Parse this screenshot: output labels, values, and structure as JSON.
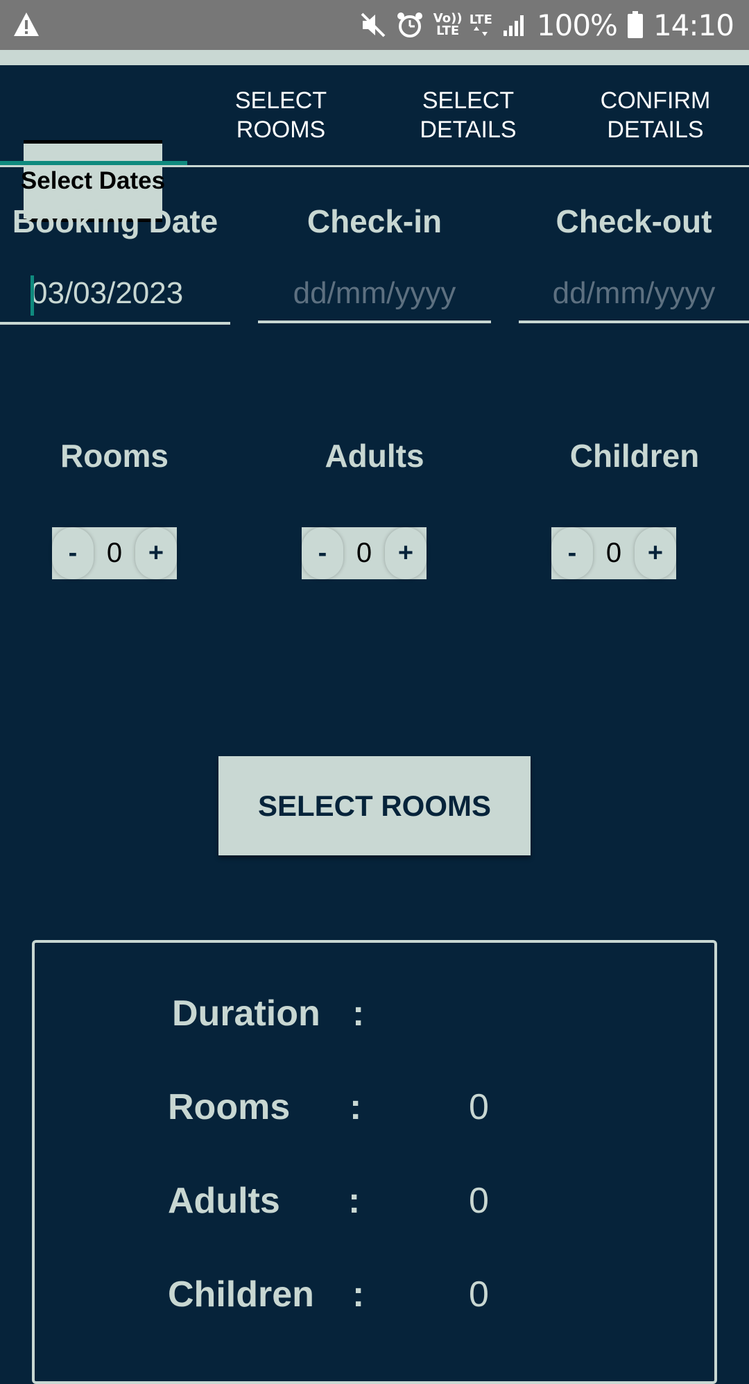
{
  "status_bar": {
    "battery": "100%",
    "time": "14:10",
    "volte": "Vo))\nLTE",
    "lte": "LTE",
    "icons": [
      "warning-icon",
      "mute-icon",
      "alarm-icon",
      "volte-icon",
      "lte-icon",
      "signal-icon",
      "battery-icon"
    ]
  },
  "tabs": [
    {
      "label": "Select Dates",
      "active": true
    },
    {
      "label": "SELECT\nROOMS",
      "active": false
    },
    {
      "label": "SELECT\nDETAILS",
      "active": false
    },
    {
      "label": "CONFIRM\nDETAILS",
      "active": false
    }
  ],
  "dates": {
    "booking_label": "Booking Date",
    "booking_value": "03/03/2023",
    "checkin_label": "Check-in",
    "checkin_placeholder": "dd/mm/yyyy",
    "checkout_label": "Check-out",
    "checkout_placeholder": "dd/mm/yyyy"
  },
  "counters": {
    "rooms": {
      "label": "Rooms",
      "value": "0"
    },
    "adults": {
      "label": "Adults",
      "value": "0"
    },
    "children": {
      "label": "Children",
      "value": "0"
    },
    "minus": "-",
    "plus": "+"
  },
  "select_rooms_button": "SELECT ROOMS",
  "summary": {
    "colon": ":",
    "duration_label": "Duration",
    "duration_value": "",
    "rooms_label": "Rooms",
    "rooms_value": "0",
    "adults_label": "Adults",
    "adults_value": "0",
    "children_label": "Children",
    "children_value": "0"
  },
  "colors": {
    "background": "#06233a",
    "accent": "#0f8a7e",
    "surface": "#c9d8d3",
    "status_bar": "#777777"
  }
}
